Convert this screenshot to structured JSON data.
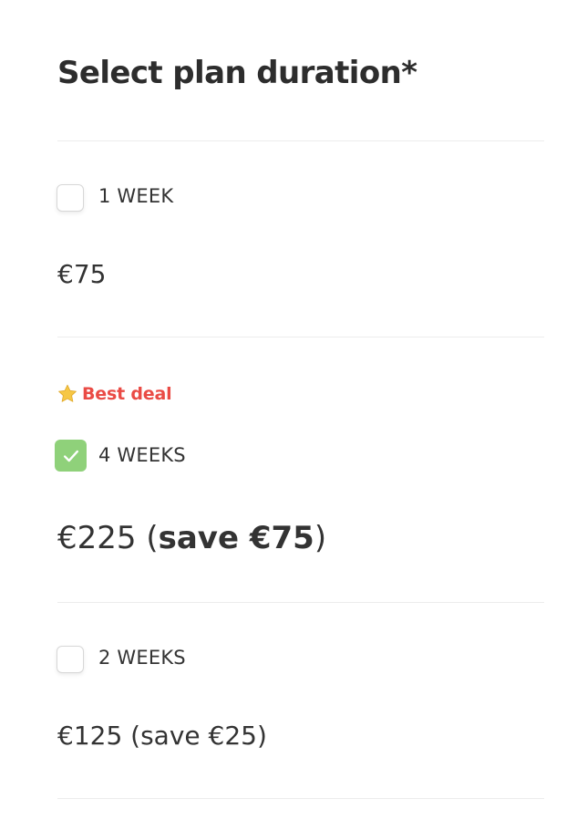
{
  "header": {
    "title": "Select plan duration*"
  },
  "options": [
    {
      "label": "1 WEEK",
      "checked": false,
      "price": "€75"
    },
    {
      "badge": "Best deal",
      "badge_icon": "star-icon",
      "label": "4 WEEKS",
      "checked": true,
      "price_main": "€225",
      "price_open": " (",
      "price_save": "save €75",
      "price_close": ")"
    },
    {
      "label": "2 WEEKS",
      "checked": false,
      "price": "€125 (save €25)"
    }
  ],
  "colors": {
    "checked": "#8fd17a",
    "badge_text": "#ea4b45",
    "star": "#f6c744",
    "divider": "#ececec"
  }
}
